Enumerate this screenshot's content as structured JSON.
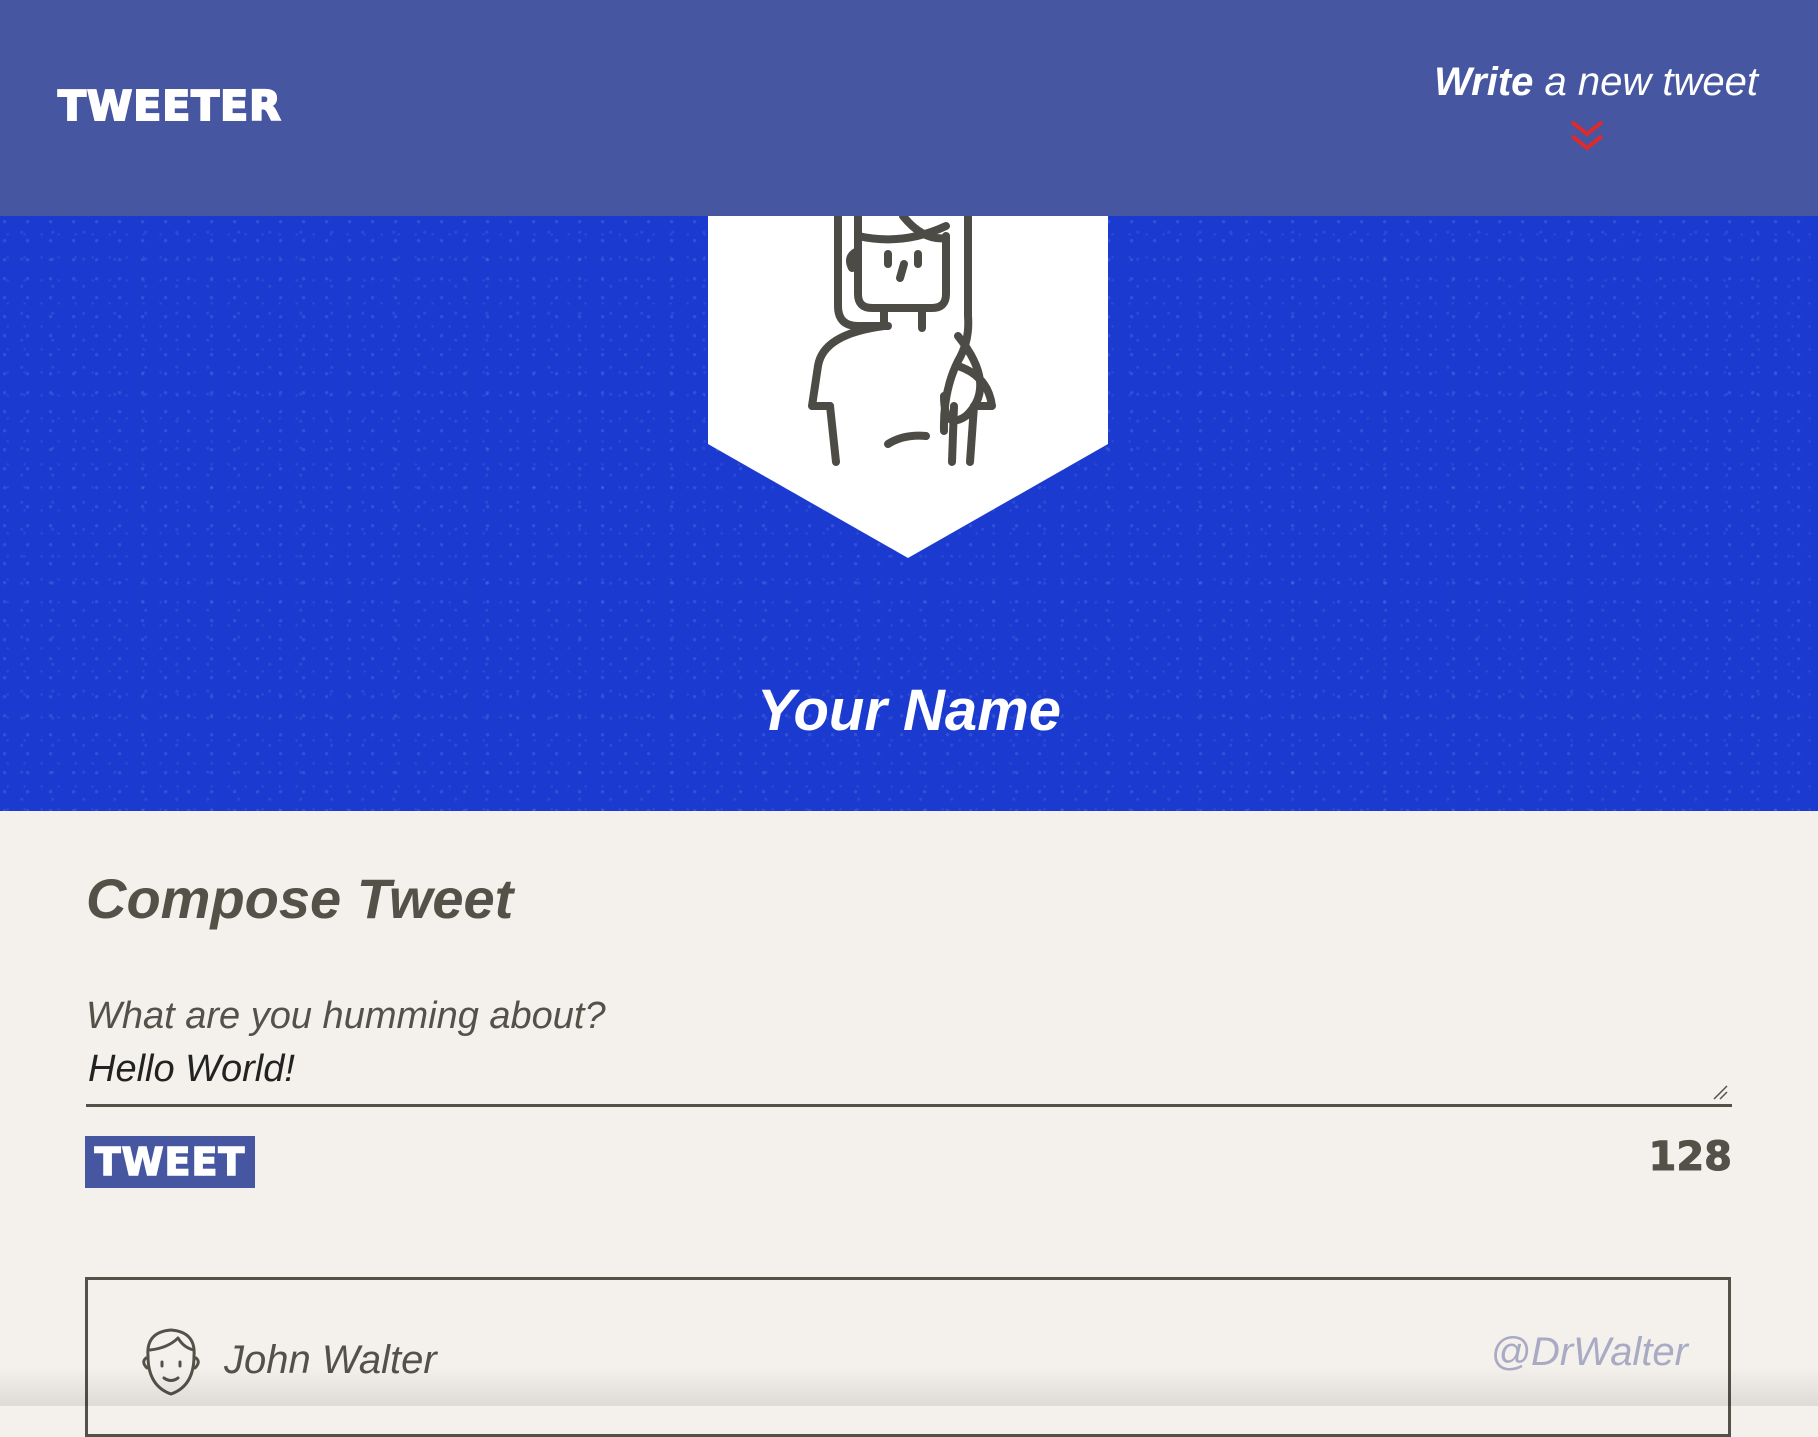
{
  "nav": {
    "brand": "TWEETER",
    "compose_toggle": {
      "strong": "Write",
      "rest": " a new tweet"
    },
    "chevron_icon": "double-chevron-down",
    "chevron_color": "#e02a2a"
  },
  "profile": {
    "name": "Your Name",
    "avatar_icon": "woman-avatar"
  },
  "compose": {
    "title": "Compose Tweet",
    "label": "What are you humming about?",
    "text_value": "Hello World!",
    "button_label": "TWEET",
    "counter": "128"
  },
  "tweet": {
    "author": "John Walter",
    "handle": "@DrWalter",
    "avatar_icon": "man-avatar"
  },
  "colors": {
    "nav_bg": "#4656a0",
    "banner_bg": "#1b3bd0",
    "page_bg": "#f4f1ec",
    "text_dark": "#545149",
    "handle": "#a9aac3",
    "accent_red": "#e02a2a"
  }
}
